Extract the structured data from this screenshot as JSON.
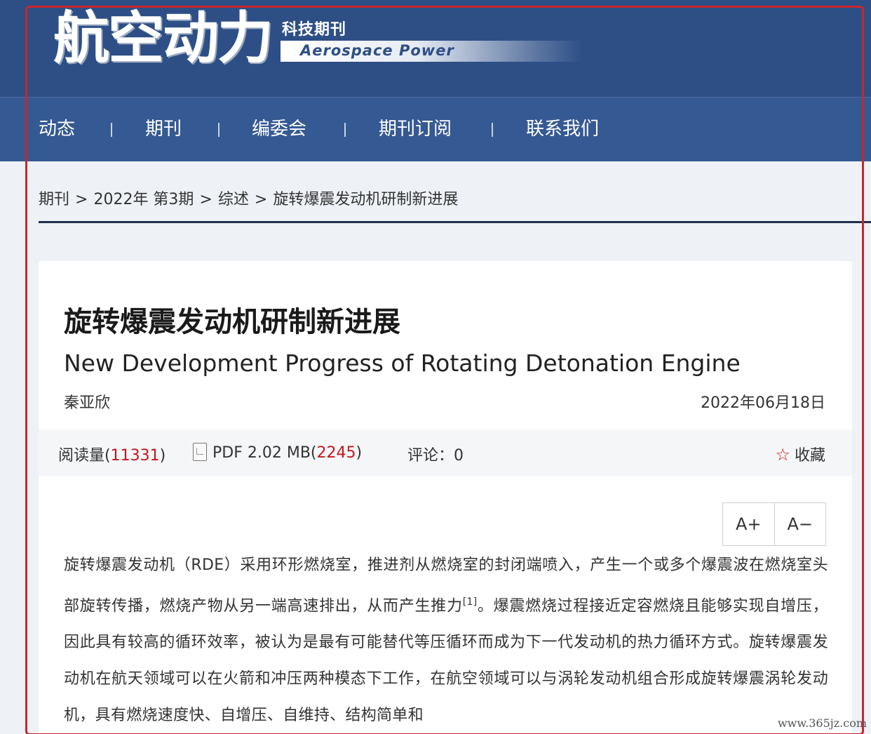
{
  "header": {
    "logo_cn": "航空动力",
    "logo_sub": "科技期刊",
    "logo_en": "Aerospace Power"
  },
  "nav": {
    "items": [
      "动态",
      "期刊",
      "编委会",
      "期刊订阅",
      "联系我们"
    ]
  },
  "breadcrumb": {
    "items": [
      "期刊",
      "2022年 第3期",
      "综述",
      "旋转爆震发动机研制新进展"
    ],
    "separator": ">"
  },
  "article": {
    "title": "旋转爆震发动机研制新进展",
    "subtitle": "New Development Progress of Rotating Detonation Engine",
    "author": "秦亚欣",
    "date": "2022年06月18日",
    "meta": {
      "reads_label": "阅读量(",
      "reads_value": "11331",
      "reads_close": ")",
      "pdf_label": "PDF 2.02 MB(",
      "pdf_downloads": "2245",
      "pdf_close": ")",
      "comments": "评论：0",
      "favorite": "收藏"
    },
    "font_controls": {
      "increase": "A+",
      "decrease": "A−"
    },
    "body_part1": "旋转爆震发动机（RDE）采用环形燃烧室，推进剂从燃烧室的封闭端喷入，产生一个或多个爆震波在燃烧室头部旋转传播，燃烧产物从另一端高速排出，从而产生推力",
    "body_ref": "[1]",
    "body_part2": "。爆震燃烧过程接近定容燃烧且能够实现自增压，因此具有较高的循环效率，被认为是最有可能替代等压循环而成为下一代发动机的热力循环方式。旋转爆震发动机在航天领域可以在火箭和冲压两种模态下工作，在航空领域可以与涡轮发动机组合形成旋转爆震涡轮发动机，具有燃烧速度快、自增压、自维持、结构简单和"
  },
  "watermark": "www.365jz.com",
  "colors": {
    "header_bg": "#2e4f86",
    "nav_bg": "#355993",
    "accent_red": "#c8161d",
    "frame_red": "#c8262c"
  }
}
